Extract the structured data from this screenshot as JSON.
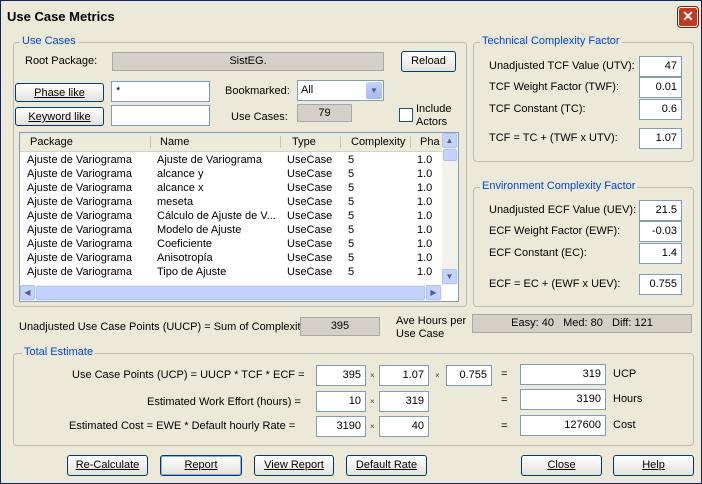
{
  "window": {
    "title": "Use Case Metrics",
    "close_glyph": "✕"
  },
  "use_cases": {
    "legend": "Use Cases",
    "root_package_label": "Root Package:",
    "root_package_value": "SistEG.",
    "reload_label": "Reload",
    "phase_like_label": "Phase like",
    "phase_like_value": "*",
    "keyword_like_label": "Keyword like",
    "keyword_like_value": "",
    "bookmarked_label": "Bookmarked:",
    "bookmarked_value": "All",
    "use_cases_label": "Use Cases:",
    "use_cases_count": "79",
    "include_actors_label_1": "Include",
    "include_actors_label_2": "Actors",
    "include_actors_checked": false
  },
  "table": {
    "columns": [
      "Package",
      "Name",
      "Type",
      "Complexity",
      "Pha"
    ],
    "rows": [
      [
        "Ajuste de Variograma",
        "Ajuste de Variograma",
        "UseCase",
        "5",
        "1.0"
      ],
      [
        "Ajuste de Variograma",
        "alcance y",
        "UseCase",
        "5",
        "1.0"
      ],
      [
        "Ajuste de Variograma",
        "alcance x",
        "UseCase",
        "5",
        "1.0"
      ],
      [
        "Ajuste de Variograma",
        "meseta",
        "UseCase",
        "5",
        "1.0"
      ],
      [
        "Ajuste de Variograma",
        "Cálculo de Ajuste de V...",
        "UseCase",
        "5",
        "1.0"
      ],
      [
        "Ajuste de Variograma",
        "Modelo de Ajuste",
        "UseCase",
        "5",
        "1.0"
      ],
      [
        "Ajuste de Variograma",
        "Coeficiente",
        "UseCase",
        "5",
        "1.0"
      ],
      [
        "Ajuste de Variograma",
        "Anisotropía",
        "UseCase",
        "5",
        "1.0"
      ],
      [
        "Ajuste de Variograma",
        "Tipo de Ajuste",
        "UseCase",
        "5",
        "1.0"
      ]
    ]
  },
  "tcf": {
    "legend": "Technical Complexity Factor",
    "utv_label": "Unadjusted TCF Value (UTV):",
    "utv_value": "47",
    "twf_label": "TCF Weight Factor (TWF):",
    "twf_value": "0.01",
    "tc_label": "TCF Constant (TC):",
    "tc_value": "0.6",
    "formula_label": "TCF = TC + (TWF x UTV):",
    "formula_value": "1.07"
  },
  "ecf": {
    "legend": "Environment Complexity Factor",
    "uev_label": "Unadjusted ECF Value (UEV):",
    "uev_value": "21.5",
    "ewf_label": "ECF Weight Factor (EWF):",
    "ewf_value": "-0.03",
    "ec_label": "ECF Constant (EC):",
    "ec_value": "1.4",
    "formula_label": "ECF  = EC + (EWF x UEV):",
    "formula_value": "0.755"
  },
  "uucp": {
    "label": "Unadjusted Use Case Points (UUCP) = Sum of Complexity",
    "value": "395",
    "ave_hours_label_1": "Ave Hours per",
    "ave_hours_label_2": "Use Case",
    "ave_hours_value": "Easy: 40   Med: 80   Diff: 121"
  },
  "total": {
    "legend": "Total Estimate",
    "ucp_label": "Use Case Points (UCP) = UUCP * TCF * ECF =",
    "ucp_a": "395",
    "ucp_b": "1.07",
    "ucp_c": "0.755",
    "ucp_result": "319",
    "ucp_unit": "UCP",
    "effort_label": "Estimated Work Effort (hours) =",
    "effort_a": "10",
    "effort_b": "319",
    "effort_result": "3190",
    "effort_unit": "Hours",
    "cost_label": "Estimated Cost  = EWE * Default hourly Rate =",
    "cost_a": "3190",
    "cost_b": "40",
    "cost_result": "127600",
    "cost_unit": "Cost",
    "times": "×",
    "equals": "="
  },
  "buttons": {
    "recalculate": "Re-Calculate",
    "report": "Report",
    "view_report": "View Report",
    "default_rate": "Default Rate",
    "close": "Close",
    "help": "Help"
  }
}
